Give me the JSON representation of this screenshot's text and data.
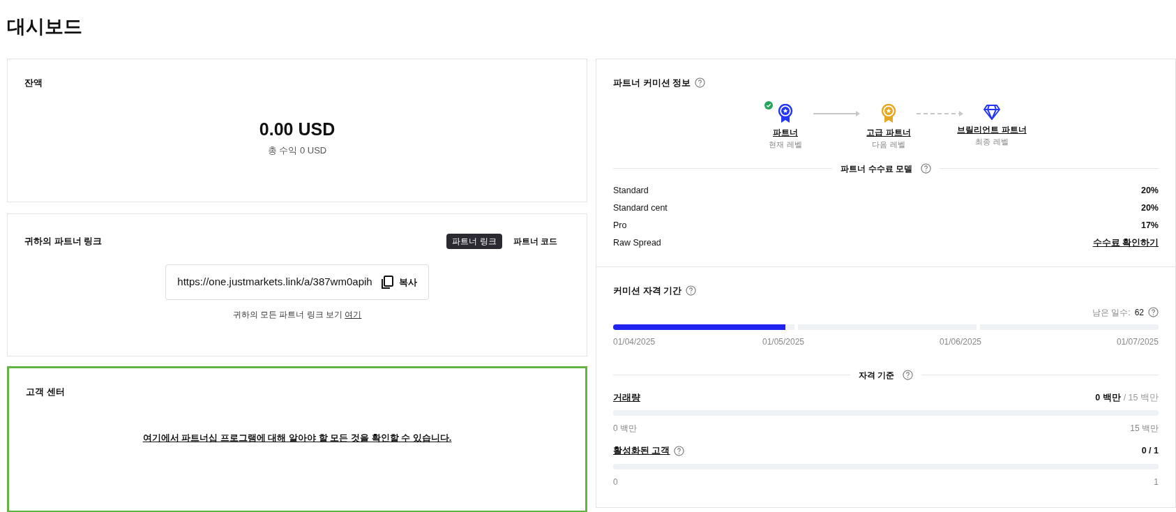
{
  "page_title": "대시보드",
  "balance": {
    "title": "잔액",
    "amount": "0.00 USD",
    "total": "총 수익 0 USD"
  },
  "partner_link": {
    "title": "귀하의 파트너 링크",
    "tabs": [
      {
        "label": "파트너 링크",
        "selected": true
      },
      {
        "label": "파트너 코드",
        "selected": false
      }
    ],
    "url": "https://one.justmarkets.link/a/387wm0apih",
    "copy_label": "복사",
    "note": "귀하의 모든 파트너 링크 보기",
    "note_link": "여기"
  },
  "help_center": {
    "title": "고객 센터",
    "link": "여기에서 파트너십 프로그램에 대해 알아야 할 모든 것을 확인할 수 있습니다.",
    "highlighted": true
  },
  "commission_info": {
    "title": "파트너 커미션 정보",
    "tiers": [
      {
        "kind": "medal",
        "color": "#2336f5",
        "name": "파트너",
        "caption": "현재 레벨",
        "achieved": true
      },
      {
        "kind": "medal",
        "color": "#e5a823",
        "name": "고급 파트너",
        "caption": "다음 레벨",
        "achieved": false
      },
      {
        "kind": "diamond",
        "color": "#2336f5",
        "name": "브릴리언트 파트너",
        "caption": "최종 레벨",
        "achieved": false
      }
    ],
    "connectors": [
      {
        "dashed": false
      },
      {
        "dashed": true
      }
    ],
    "model_title": "파트너 수수료 모델",
    "rates": [
      {
        "kind": "value",
        "name": "Standard",
        "value": "20%"
      },
      {
        "kind": "value",
        "name": "Standard cent",
        "value": "20%"
      },
      {
        "kind": "value",
        "name": "Pro",
        "value": "17%"
      },
      {
        "kind": "link",
        "name": "Raw Spread",
        "value": "수수료 확인하기"
      }
    ]
  },
  "eligibility": {
    "title": "커미션 자격 기간",
    "days_label": "남은 일수:",
    "days_value": "62",
    "period": {
      "level": 0.316
    },
    "dates": [
      "01/04/2025",
      "01/05/2025",
      "01/06/2025",
      "01/07/2025"
    ],
    "criteria_title": "자격 기준",
    "criteria": [
      {
        "name": "거래량",
        "help": false,
        "current": "0 백만",
        "target": "/ 15 백만",
        "level": 0,
        "min": "0 백만",
        "max": "15 백만"
      },
      {
        "name": "활성화된 고객",
        "help": true,
        "current": "0 / 1",
        "level": 0,
        "min": "0",
        "max": "1"
      }
    ]
  }
}
